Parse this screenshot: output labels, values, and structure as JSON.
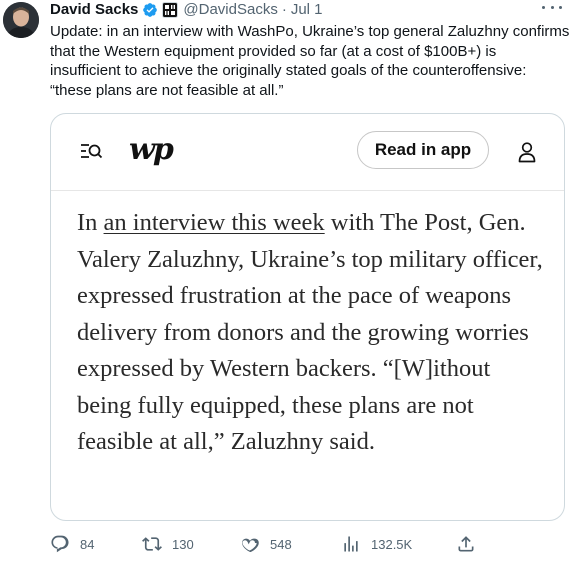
{
  "tweet": {
    "display_name": "David Sacks",
    "handle": "@DavidSacks",
    "separator": "·",
    "date": "Jul 1",
    "text": "Update: in an interview with WashPo, Ukraine’s top general Zaluzhny confirms that the Western equipment provided so far (at a cost of $100B+) is insufficient to achieve the originally stated goals of the counteroffensive: “these plans are not feasible at all.”",
    "verified_icon": "verified-badge-icon",
    "affiliate_badge": "all-in-podcast-badge"
  },
  "card": {
    "logo_text": "wp",
    "read_in_app_label": "Read in app",
    "article": {
      "prefix": "In ",
      "link_text": "an interview this week",
      "body": " with The Post, Gen. Valery Zaluzhny, Ukraine’s top military officer, expressed frustration at the pace of weapons delivery from donors and the growing worries expressed by Western backers. “[W]ithout being fully equipped, these plans are not feasible at all,” Zaluzhny said."
    }
  },
  "actions": {
    "reply_count": "84",
    "retweet_count": "130",
    "like_count": "548",
    "views_count": "132.5K"
  },
  "colors": {
    "verified": "#1d9bf0",
    "muted": "#536471",
    "border": "#cfd9de"
  }
}
